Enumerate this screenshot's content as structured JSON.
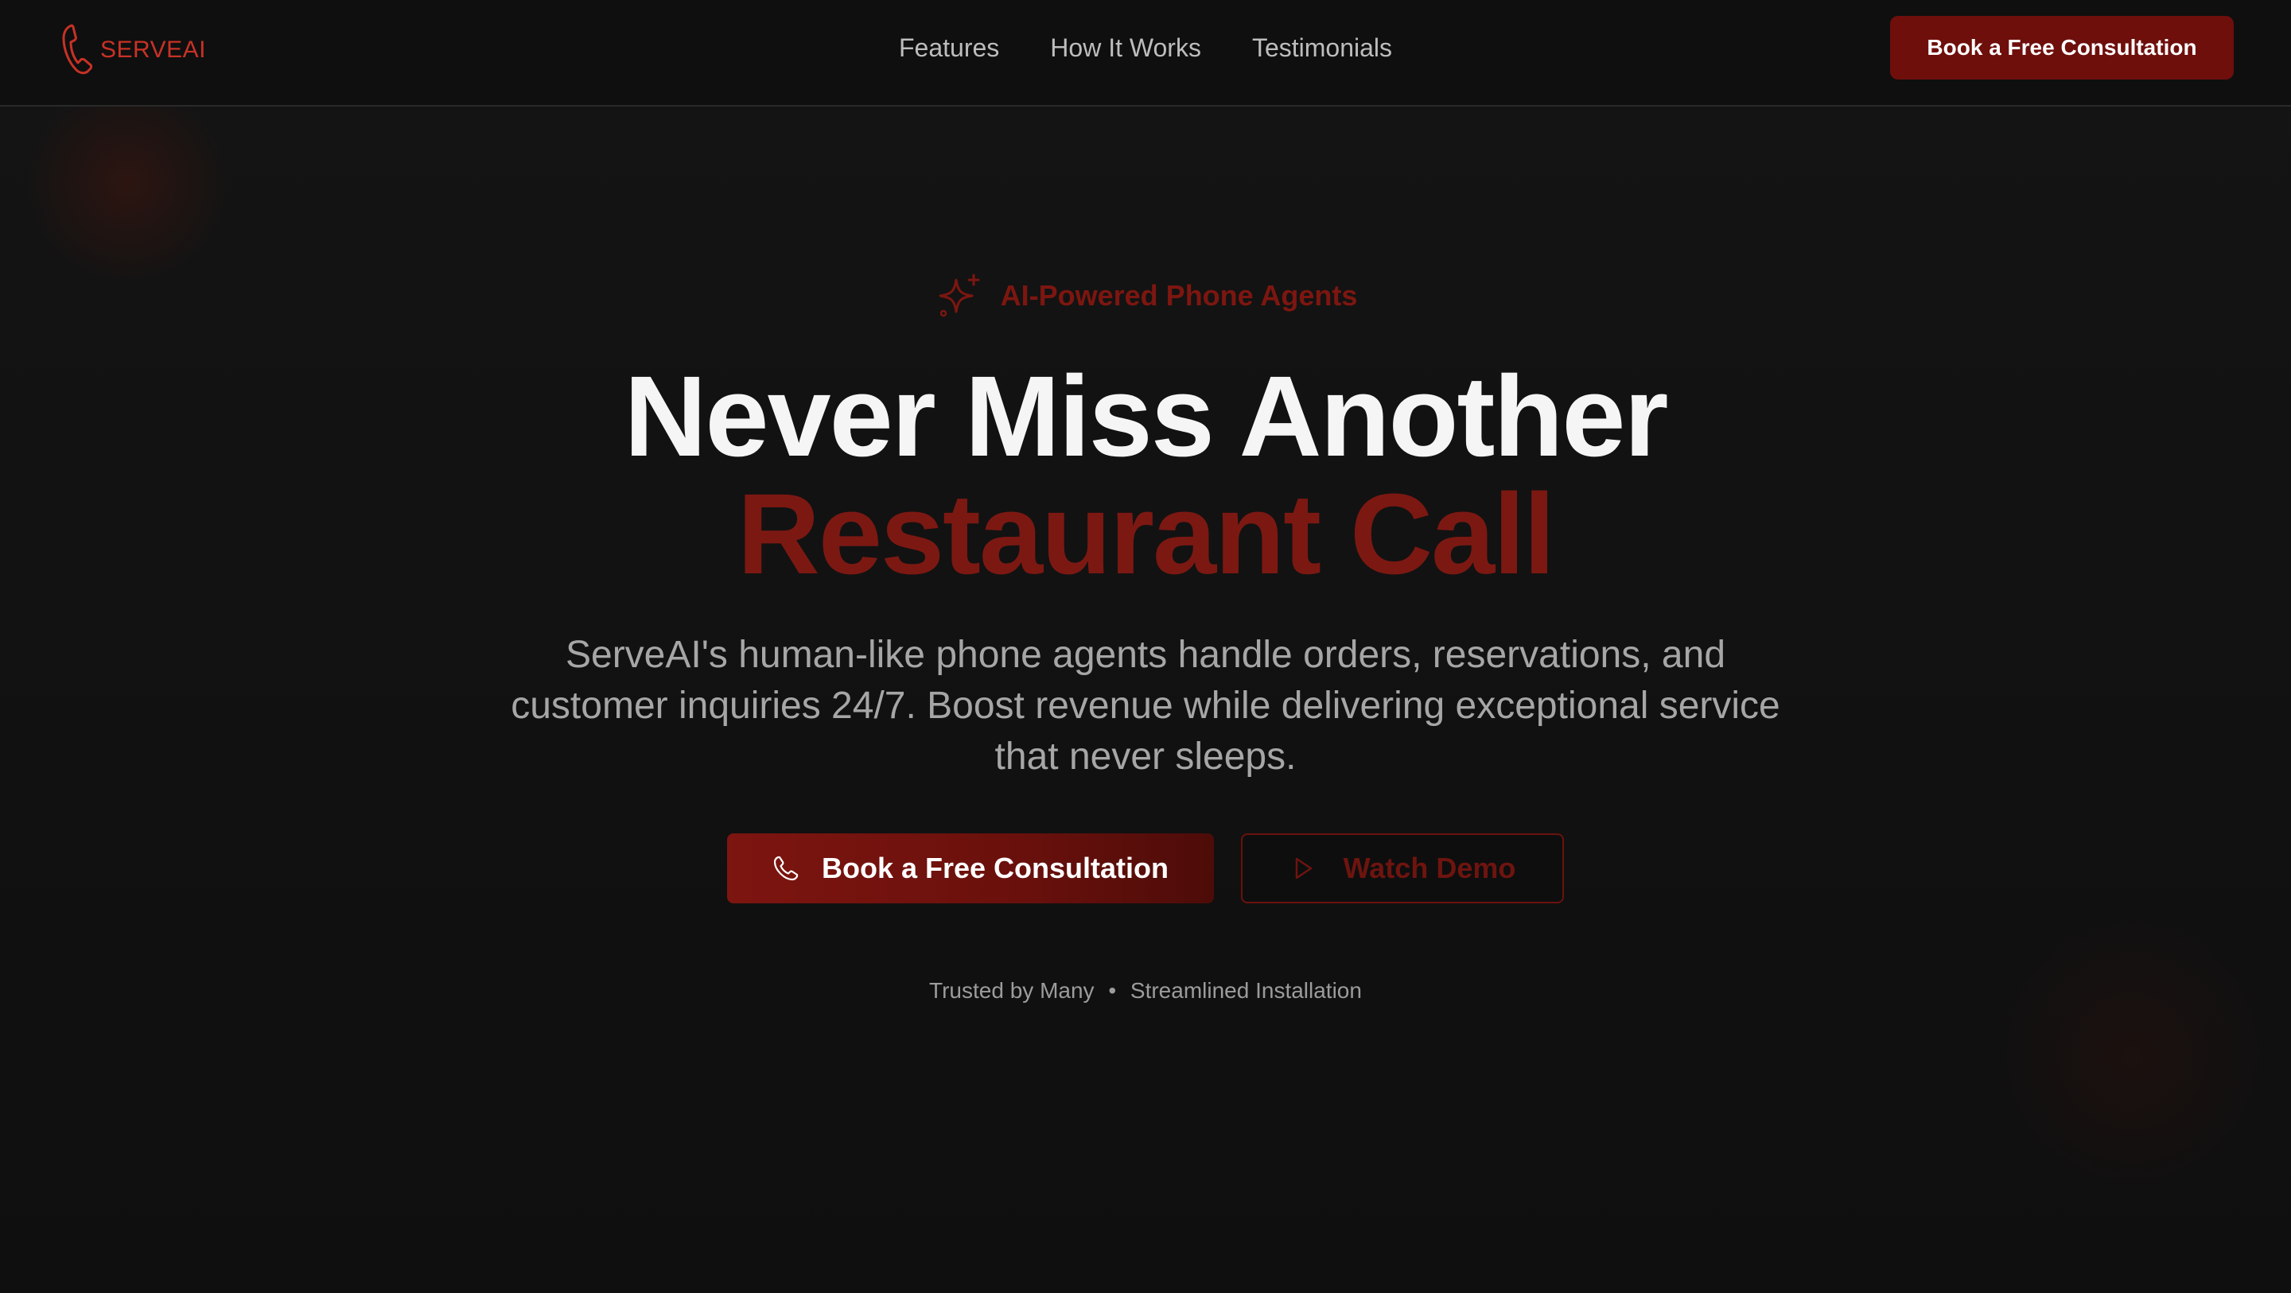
{
  "brand": {
    "name": "SERVEAI",
    "accent_color": "#7c1812",
    "background_color": "#121212"
  },
  "nav": {
    "links": [
      {
        "label": "Features"
      },
      {
        "label": "How It Works"
      },
      {
        "label": "Testimonials"
      }
    ],
    "cta_label": "Book a Free Consultation"
  },
  "hero": {
    "badge": {
      "icon": "sparkle-icon",
      "text": "AI-Powered Phone Agents"
    },
    "headline_line1": "Never Miss Another",
    "headline_line2": "Restaurant Call",
    "subtitle": "ServeAI's human-like phone agents handle orders, reservations, and customer inquiries 24/7. Boost revenue while delivering exceptional service that never sleeps.",
    "primary_cta": {
      "icon": "phone-icon",
      "label": "Book a Free Consultation"
    },
    "secondary_cta": {
      "icon": "play-icon",
      "label": "Watch Demo"
    },
    "trust": {
      "part1": "Trusted by Many",
      "separator": "•",
      "part2": "Streamlined Installation"
    }
  }
}
